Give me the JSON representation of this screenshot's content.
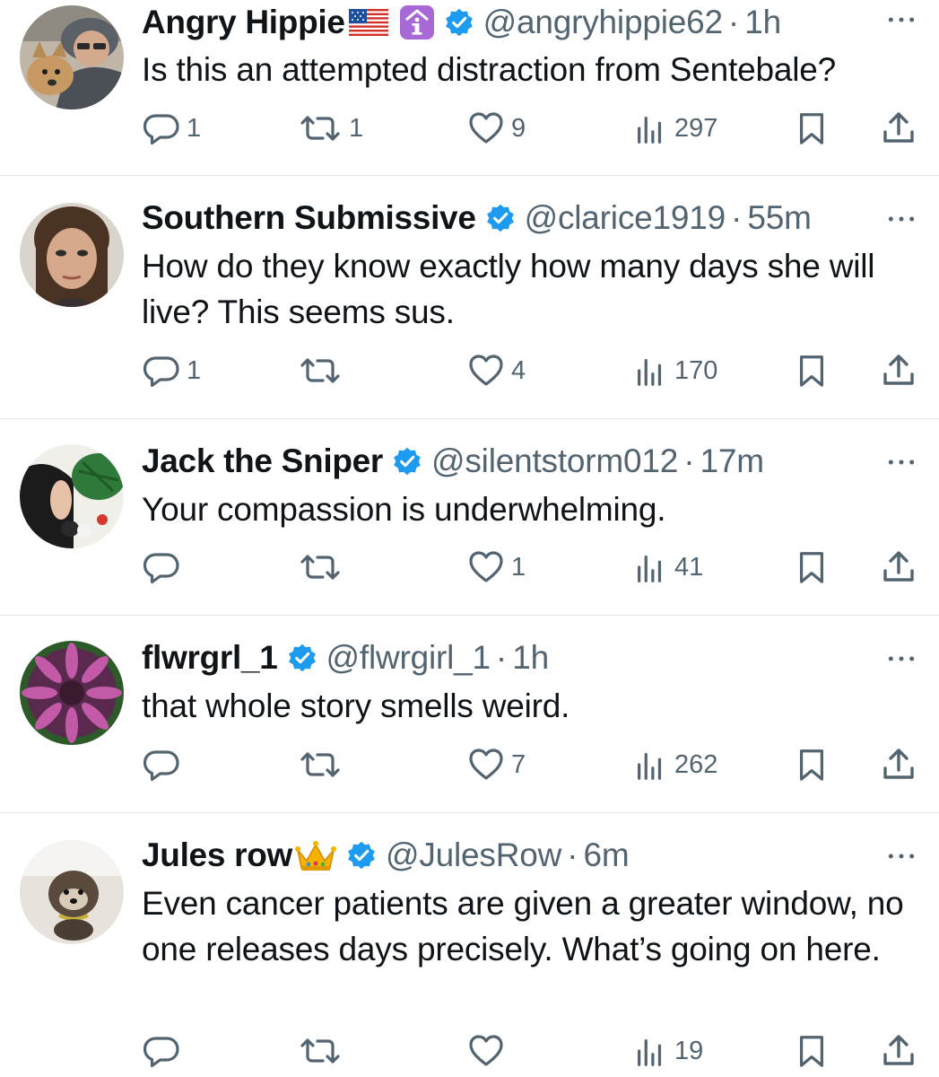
{
  "icons": {
    "reply": "reply-icon",
    "retweet": "retweet-icon",
    "like": "heart-icon",
    "views": "views-icon",
    "bookmark": "bookmark-icon",
    "share": "share-icon",
    "more": "more-icon",
    "verified": "verified-badge-icon"
  },
  "colors": {
    "text": "#0f1419",
    "muted": "#536471",
    "verified": "#1d9bf0",
    "divider": "#e3e7ea"
  },
  "tweets": [
    {
      "display_name": "Angry Hippie",
      "name_emojis": [
        "us-flag",
        "info-emoji"
      ],
      "handle": "@angryhippie62",
      "separator": "·",
      "time": "1h",
      "text": "Is this an attempted distraction from Sentebale?",
      "replies": "1",
      "retweets": "1",
      "likes": "9",
      "views": "297"
    },
    {
      "display_name": "Southern Submissive",
      "name_emojis": [],
      "handle": "@clarice1919",
      "separator": "·",
      "time": "55m",
      "text": "How do they know exactly how many days she will live? This seems sus.",
      "replies": "1",
      "retweets": "",
      "likes": "4",
      "views": "170"
    },
    {
      "display_name": "Jack the Sniper",
      "name_emojis": [],
      "handle": "@silentstorm012",
      "separator": "·",
      "time": "17m",
      "text": "Your compassion is underwhelming.",
      "replies": "",
      "retweets": "",
      "likes": "1",
      "views": "41"
    },
    {
      "display_name": "flwrgrl_1",
      "name_emojis": [],
      "handle": "@flwrgirl_1",
      "separator": "·",
      "time": "1h",
      "text": "that whole story smells weird.",
      "replies": "",
      "retweets": "",
      "likes": "7",
      "views": "262"
    },
    {
      "display_name": "Jules row",
      "name_emojis": [
        "crown"
      ],
      "handle": "@JulesRow",
      "separator": "·",
      "time": "6m",
      "text": "Even cancer patients are given a greater window, no one releases days precisely. What’s going on here.",
      "replies": "",
      "retweets": "",
      "likes": "",
      "views": "19"
    }
  ]
}
